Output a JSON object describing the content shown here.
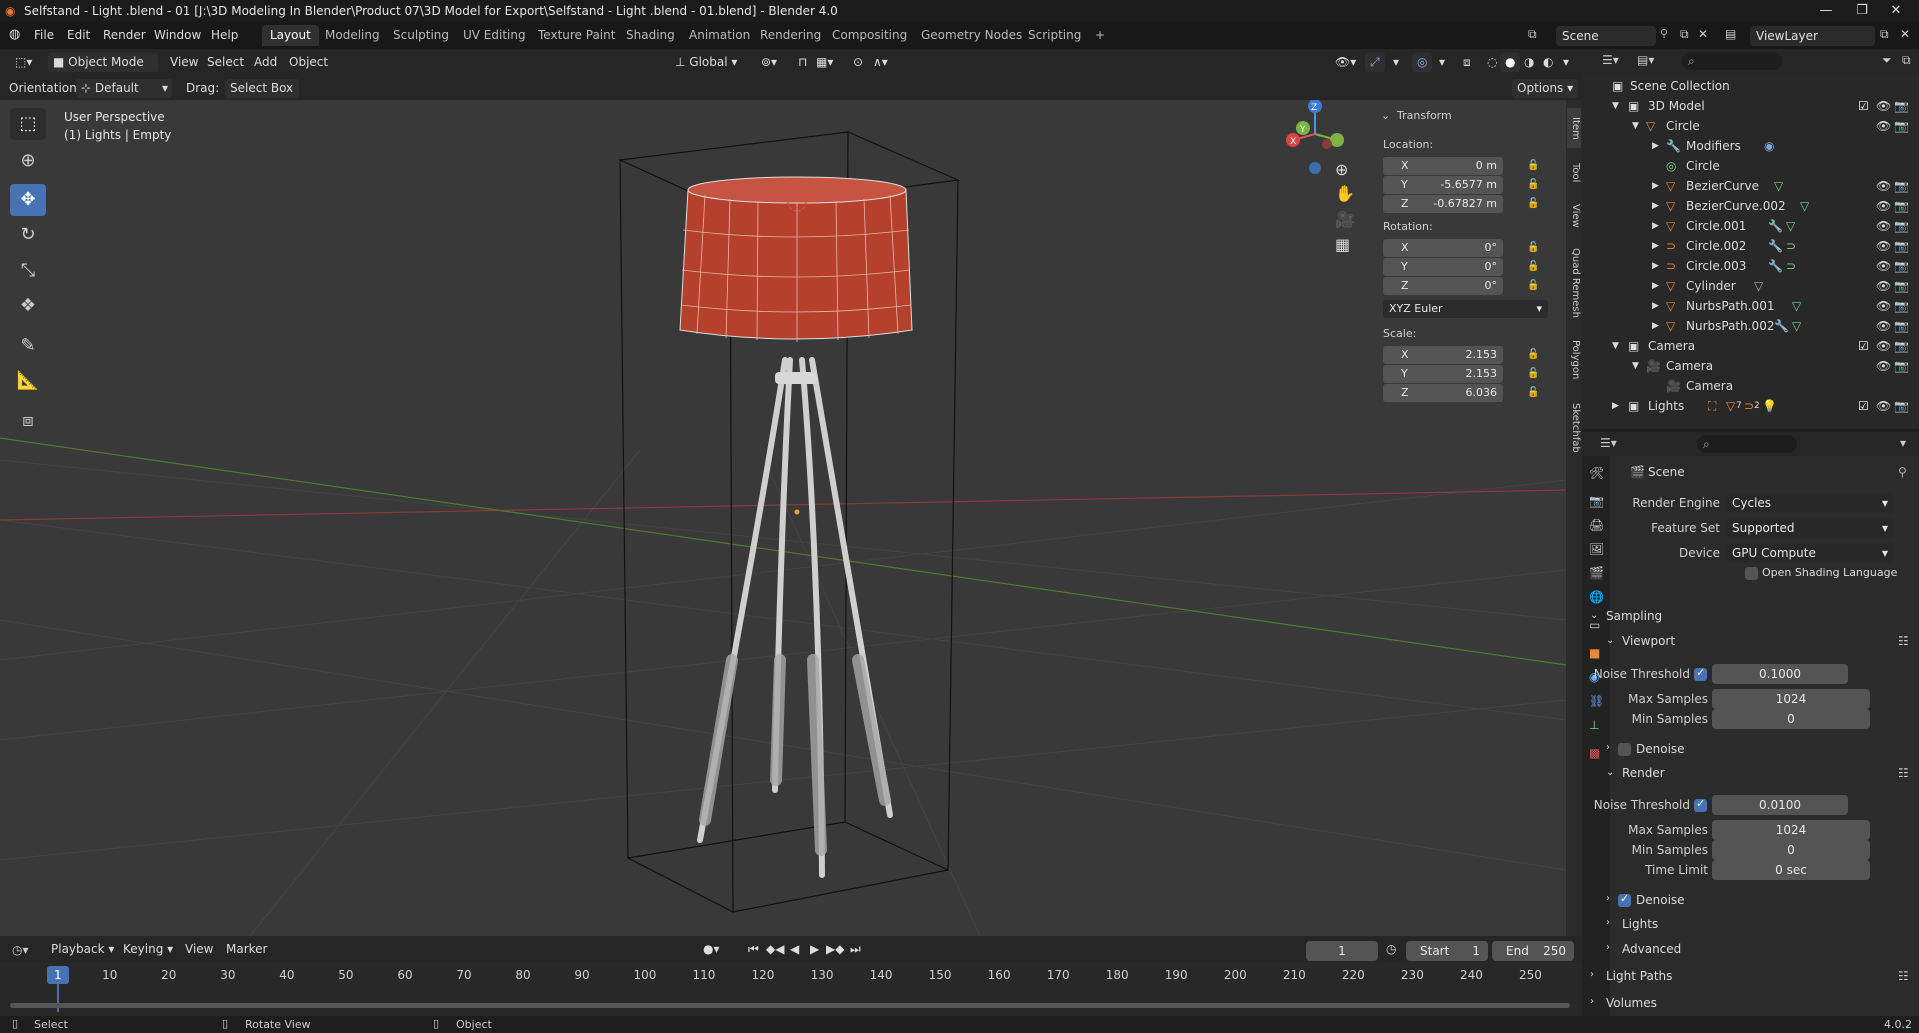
{
  "window": {
    "title": "Selfstand - Light .blend - 01 [J:\\3D Modeling In Blender\\Product 07\\3D Model for Export\\Selfstand - Light .blend - 01.blend] - Blender 4.0"
  },
  "menu": [
    "File",
    "Edit",
    "Render",
    "Window",
    "Help"
  ],
  "workspaces": [
    "Layout",
    "Modeling",
    "Sculpting",
    "UV Editing",
    "Texture Paint",
    "Shading",
    "Animation",
    "Rendering",
    "Compositing",
    "Geometry Nodes",
    "Scripting"
  ],
  "active_workspace": "Layout",
  "scene_name": "Scene",
  "view_layer": "ViewLayer",
  "viewport_header": {
    "mode": "Object Mode",
    "menus": [
      "View",
      "Select",
      "Add",
      "Object"
    ],
    "transform_orientation": "Global",
    "orientation_label": "Orientation:",
    "orientation_value": "Default",
    "drag_label": "Drag:",
    "drag_value": "Select Box",
    "options": "Options"
  },
  "viewport_info": {
    "line1": "User Perspective",
    "line2": "(1) Lights | Empty"
  },
  "npanel": {
    "header": "Transform",
    "location_label": "Location:",
    "location": [
      {
        "axis": "X",
        "value": "0 m"
      },
      {
        "axis": "Y",
        "value": "-5.6577 m"
      },
      {
        "axis": "Z",
        "value": "-0.67827 m"
      }
    ],
    "rotation_label": "Rotation:",
    "rotation": [
      {
        "axis": "X",
        "value": "0°"
      },
      {
        "axis": "Y",
        "value": "0°"
      },
      {
        "axis": "Z",
        "value": "0°"
      }
    ],
    "rotation_mode": "XYZ Euler",
    "scale_label": "Scale:",
    "scale": [
      {
        "axis": "X",
        "value": "2.153"
      },
      {
        "axis": "Y",
        "value": "2.153"
      },
      {
        "axis": "Z",
        "value": "6.036"
      }
    ],
    "tabs": [
      "Item",
      "Tool",
      "View",
      "Quad Remesh",
      "Polygon",
      "Sketchfab"
    ]
  },
  "outliner": {
    "rows": [
      {
        "label": "Scene Collection"
      },
      {
        "label": "3D Model"
      },
      {
        "label": "Circle"
      },
      {
        "label": "Modifiers"
      },
      {
        "label": "Circle"
      },
      {
        "label": "BezierCurve"
      },
      {
        "label": "BezierCurve.002"
      },
      {
        "label": "Circle.001"
      },
      {
        "label": "Circle.002"
      },
      {
        "label": "Circle.003"
      },
      {
        "label": "Cylinder"
      },
      {
        "label": "NurbsPath.001"
      },
      {
        "label": "NurbsPath.002"
      },
      {
        "label": "Camera"
      },
      {
        "label": "Camera"
      },
      {
        "label": "Camera"
      },
      {
        "label": "Lights"
      }
    ],
    "lights_count_a": "7",
    "lights_count_b": "2"
  },
  "properties": {
    "context": "Scene",
    "render_engine_label": "Render Engine",
    "render_engine": "Cycles",
    "feature_set_label": "Feature Set",
    "feature_set": "Supported",
    "device_label": "Device",
    "device": "GPU Compute",
    "osl_label": "Open Shading Language",
    "sampling": "Sampling",
    "viewport": "Viewport",
    "vp_noise_label": "Noise Threshold",
    "vp_noise": "0.1000",
    "vp_max_label": "Max Samples",
    "vp_max": "1024",
    "vp_min_label": "Min Samples",
    "vp_min": "0",
    "vp_denoise": "Denoise",
    "render": "Render",
    "r_noise_label": "Noise Threshold",
    "r_noise": "0.0100",
    "r_max_label": "Max Samples",
    "r_max": "1024",
    "r_min_label": "Min Samples",
    "r_min": "0",
    "r_time_label": "Time Limit",
    "r_time": "0 sec",
    "r_denoise": "Denoise",
    "lights": "Lights",
    "advanced": "Advanced",
    "light_paths": "Light Paths",
    "volumes": "Volumes"
  },
  "timeline": {
    "menus": [
      "Playback",
      "Keying",
      "View",
      "Marker"
    ],
    "current_frame": "1",
    "start_label": "Start",
    "start": "1",
    "end_label": "End",
    "end": "250",
    "ticks": [
      "1",
      "10",
      "20",
      "30",
      "40",
      "50",
      "60",
      "70",
      "80",
      "90",
      "100",
      "110",
      "120",
      "130",
      "140",
      "150",
      "160",
      "170",
      "180",
      "190",
      "200",
      "210",
      "220",
      "230",
      "240",
      "250"
    ]
  },
  "statusbar": {
    "select": "Select",
    "rotate": "Rotate View",
    "object": "Object",
    "version": "4.0.2"
  },
  "colors": {
    "accent": "#4772b3",
    "shade": "#b5402c",
    "wire": "#c9c9c9"
  }
}
